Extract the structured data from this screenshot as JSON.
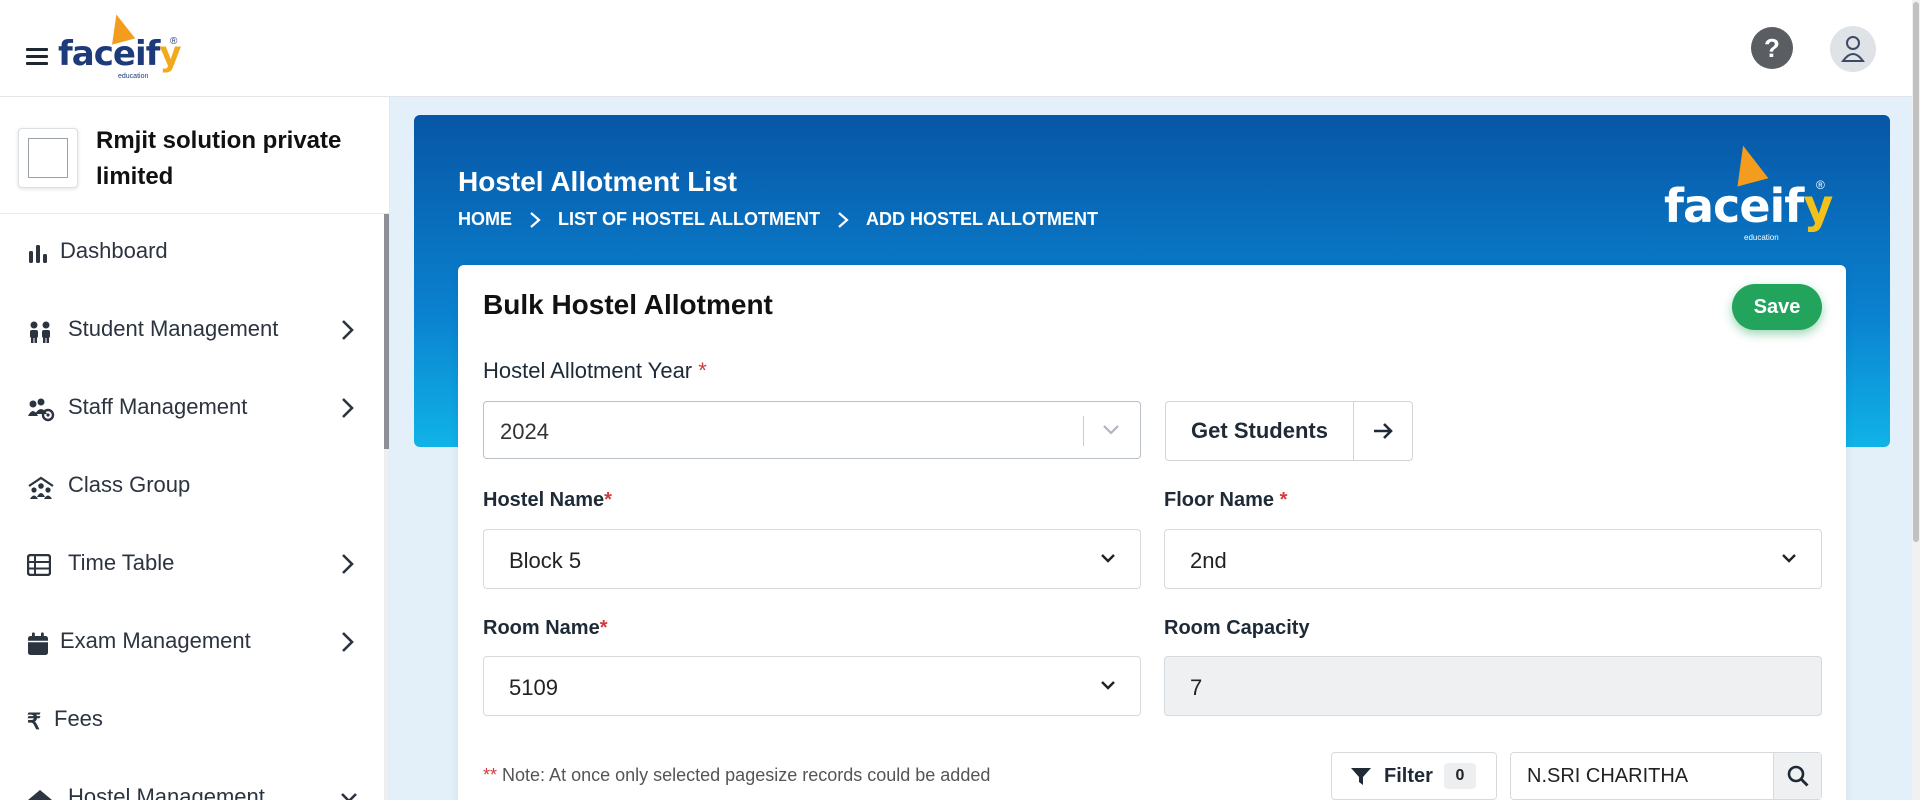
{
  "brand": {
    "logo_text": "facei",
    "logo_y": "y",
    "logo_mid": "f",
    "logo_sub": "education",
    "logo_reg": "®"
  },
  "header": {
    "help_label": "?"
  },
  "sidebar": {
    "org_name": "Rmjit solution private limited",
    "items": [
      {
        "label": "Dashboard",
        "icon": "bar-chart-icon",
        "has_submenu": false
      },
      {
        "label": "Student Management",
        "icon": "students-icon",
        "has_submenu": true
      },
      {
        "label": "Staff Management",
        "icon": "staff-icon",
        "has_submenu": true
      },
      {
        "label": "Class Group",
        "icon": "class-group-icon",
        "has_submenu": false
      },
      {
        "label": "Time Table",
        "icon": "table-icon",
        "has_submenu": true
      },
      {
        "label": "Exam Management",
        "icon": "calendar-icon",
        "has_submenu": true
      },
      {
        "label": "Fees",
        "icon": "rupee-icon",
        "has_submenu": false
      },
      {
        "label": "Hostel Management",
        "icon": "hostel-icon",
        "has_submenu": true
      }
    ]
  },
  "page": {
    "title": "Hostel Allotment List",
    "breadcrumb": [
      "HOME",
      "LIST OF HOSTEL ALLOTMENT",
      "ADD HOSTEL ALLOTMENT"
    ]
  },
  "form": {
    "title": "Bulk Hostel Allotment",
    "save_label": "Save",
    "year_label": "Hostel Allotment Year",
    "year_value": "2024",
    "get_students_label": "Get Students",
    "hostel_label": "Hostel Name",
    "hostel_value": "Block 5",
    "floor_label": "Floor Name",
    "floor_value": "2nd",
    "room_label": "Room Name",
    "room_value": "5109",
    "capacity_label": "Room Capacity",
    "capacity_value": "7",
    "required_mark": "*",
    "note_stars": "**",
    "note_text": "Note: At once only selected pagesize records could be added",
    "filter_label": "Filter",
    "filter_count": "0",
    "search_value": "N.SRI CHARITHA"
  },
  "colors": {
    "primary": "#0a82cf",
    "save": "#22a45d",
    "required": "#d23a3a"
  }
}
